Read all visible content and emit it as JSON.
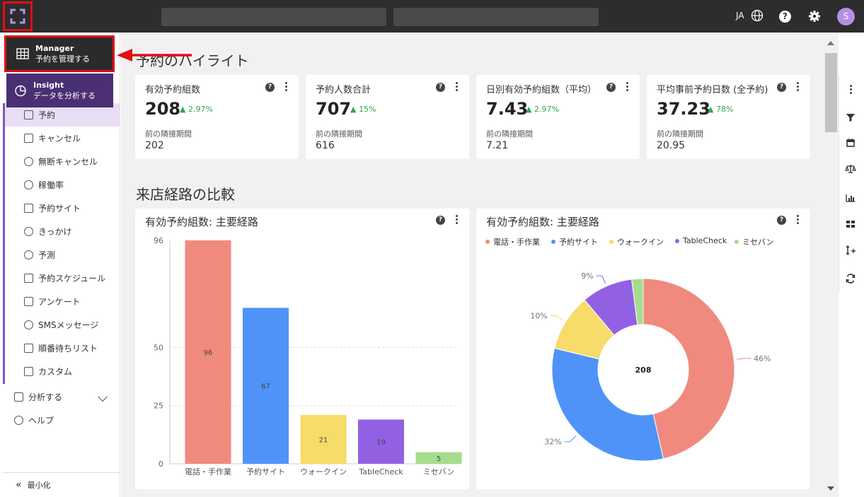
{
  "colors": {
    "topbar": "#2d2d2d",
    "accent": "#7e57c2",
    "highlight": "#e30d15",
    "positive": "#2eaa4a",
    "series": [
      "#f08a7e",
      "#4f93f8",
      "#f8dc6a",
      "#9261e3",
      "#a5dd8d"
    ]
  },
  "topbar": {
    "lang": "JA",
    "avatar_initial": "S",
    "icons": [
      "logo-icon",
      "globe-icon",
      "help-icon",
      "gear-icon"
    ]
  },
  "menu": {
    "manager": {
      "title": "Manager",
      "subtitle": "予約を管理する",
      "icon": "grid-icon"
    },
    "insight": {
      "title": "Insight",
      "subtitle": "データを分析する",
      "icon": "pie-icon"
    }
  },
  "sidebar": {
    "items": [
      {
        "label": "予約",
        "icon": "calendar-check-icon",
        "active": true
      },
      {
        "label": "キャンセル",
        "icon": "calendar-x-icon"
      },
      {
        "label": "無断キャンセル",
        "icon": "circle-x-icon"
      },
      {
        "label": "稼働率",
        "icon": "people-icon"
      },
      {
        "label": "予約サイト",
        "icon": "monitor-icon"
      },
      {
        "label": "きっかけ",
        "icon": "share-icon"
      },
      {
        "label": "予測",
        "icon": "eye-icon"
      },
      {
        "label": "予約スケジュール",
        "icon": "calendar-icon"
      },
      {
        "label": "アンケート",
        "icon": "form-icon"
      },
      {
        "label": "SMSメッセージ",
        "icon": "chat-icon"
      },
      {
        "label": "順番待ちリスト",
        "icon": "hourglass-icon"
      },
      {
        "label": "カスタム",
        "icon": "custom-icon"
      }
    ],
    "analyze": "分析する",
    "help": "ヘルプ",
    "minimize": "最小化"
  },
  "highlights": {
    "title": "予約のハイライト",
    "kpis": [
      {
        "title": "有効予約組数",
        "value": "208",
        "delta": "▲ 2.97%",
        "prev_label": "前の隣接期間",
        "prev": "202"
      },
      {
        "title": "予約人数合計",
        "value": "707",
        "delta": "▲ 15%",
        "prev_label": "前の隣接期間",
        "prev": "616"
      },
      {
        "title": "日別有効予約組数（平均）",
        "value": "7.43",
        "delta": "▲ 2.97%",
        "prev_label": "前の隣接期間",
        "prev": "7.21"
      },
      {
        "title": "平均事前予約日数 (全予約)",
        "value": "37.23",
        "delta": "▲ 78%",
        "prev_label": "前の隣接期間",
        "prev": "20.95"
      }
    ]
  },
  "comparison": {
    "title": "来店経路の比較"
  },
  "chart_data": [
    {
      "type": "bar",
      "title": "有効予約組数: 主要経路",
      "categories": [
        "電話・手作業",
        "予約サイト",
        "ウォークイン",
        "TableCheck",
        "ミセバン"
      ],
      "values": [
        96,
        67,
        21,
        19,
        5
      ],
      "y_ticks": [
        "96",
        "50",
        "25",
        "0"
      ],
      "ylim": [
        0,
        96
      ],
      "grid": true
    },
    {
      "type": "pie",
      "title": "有効予約組数: 主要経路",
      "center_label": "208",
      "categories": [
        "電話・手作業",
        "予約サイト",
        "ウォークイン",
        "TableCheck",
        "ミセバン"
      ],
      "values": [
        46,
        32,
        10,
        9,
        2
      ],
      "slice_labels": [
        "46%",
        "32%",
        "10%",
        "9%",
        ""
      ],
      "legend": "top"
    }
  ]
}
